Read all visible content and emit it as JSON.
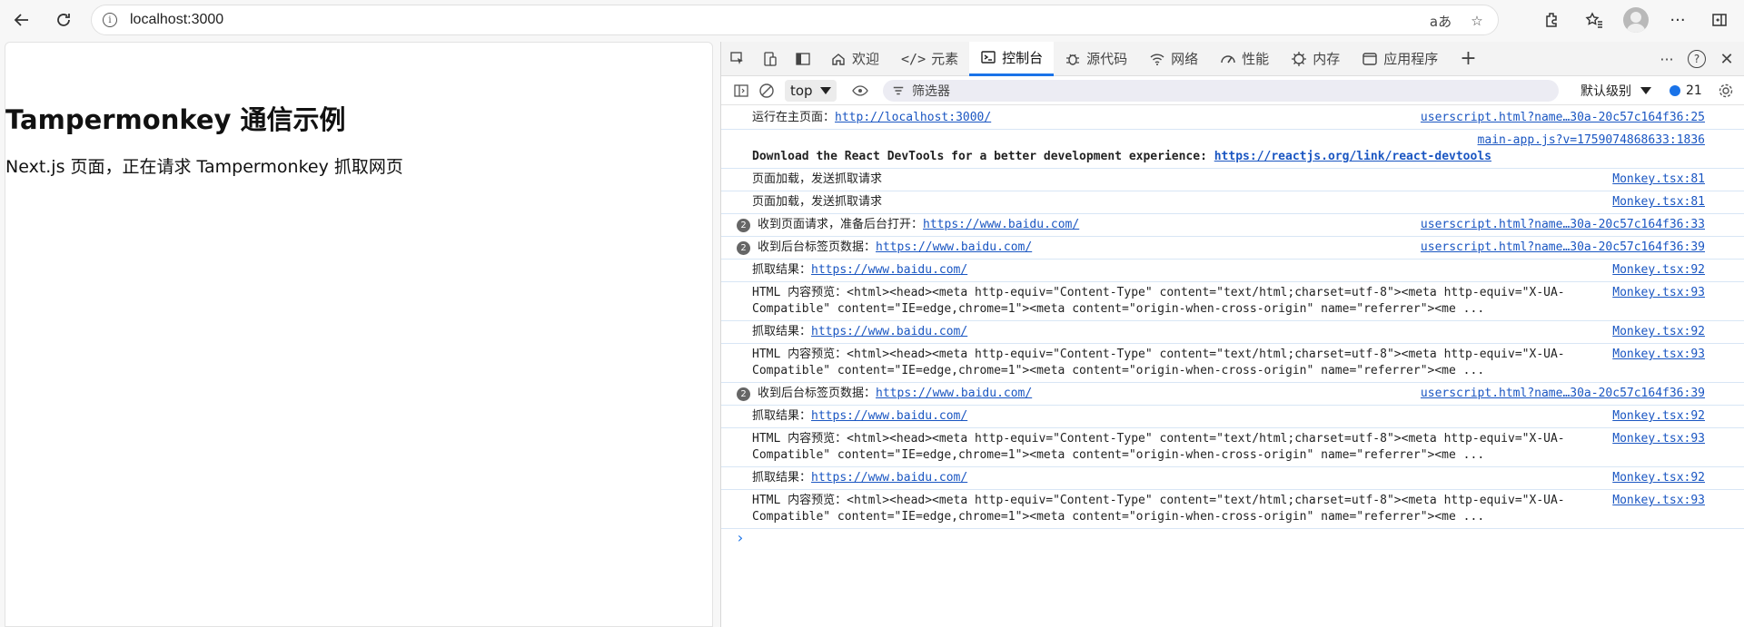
{
  "browser": {
    "url": "localhost:3000",
    "translate_icon": "aあ"
  },
  "page": {
    "title": "Tampermonkey 通信示例",
    "subtitle": "Next.js 页面，正在请求 Tampermonkey 抓取网页"
  },
  "devtools": {
    "tabs": [
      {
        "label": "欢迎"
      },
      {
        "label": "元素"
      },
      {
        "label": "控制台"
      },
      {
        "label": "源代码"
      },
      {
        "label": "网络"
      },
      {
        "label": "性能"
      },
      {
        "label": "内存"
      },
      {
        "label": "应用程序"
      }
    ],
    "context": "top",
    "filter_placeholder": "筛选器",
    "level_label": "默认级别",
    "issue_count": "21"
  },
  "console": {
    "rows": [
      {
        "count": "",
        "text": "运行在主页面：",
        "link": "http://localhost:3000/",
        "source": "userscript.html?name…30a-20c57c164f36:25",
        "bold": false
      },
      {
        "count": "",
        "text": "Download the React DevTools for a better development experience: ",
        "link": "https://reactjs.org/link/react-devtools",
        "source": "main-app.js?v=1759074868633:1836",
        "bold": true
      },
      {
        "count": "",
        "text": "页面加载，发送抓取请求",
        "link": "",
        "source": "Monkey.tsx:81",
        "bold": false
      },
      {
        "count": "",
        "text": "页面加载，发送抓取请求",
        "link": "",
        "source": "Monkey.tsx:81",
        "bold": false
      },
      {
        "count": "2",
        "text": "收到页面请求，准备后台打开：",
        "link": "https://www.baidu.com/",
        "source": "userscript.html?name…30a-20c57c164f36:33",
        "bold": false
      },
      {
        "count": "2",
        "text": "收到后台标签页数据：",
        "link": "https://www.baidu.com/",
        "source": "userscript.html?name…30a-20c57c164f36:39",
        "bold": false
      },
      {
        "count": "",
        "text": "抓取结果：",
        "link": "https://www.baidu.com/",
        "source": "Monkey.tsx:92",
        "bold": false
      },
      {
        "count": "",
        "text": "HTML 内容预览：<html><head><meta http-equiv=\"Content-Type\" content=\"text/html;charset=utf-8\"><meta http-equiv=\"X-UA-Compatible\" content=\"IE=edge,chrome=1\"><meta content=\"origin-when-cross-origin\" name=\"referrer\"><me ...",
        "link": "",
        "source": "Monkey.tsx:93",
        "bold": false
      },
      {
        "count": "",
        "text": "抓取结果：",
        "link": "https://www.baidu.com/",
        "source": "Monkey.tsx:92",
        "bold": false
      },
      {
        "count": "",
        "text": "HTML 内容预览：<html><head><meta http-equiv=\"Content-Type\" content=\"text/html;charset=utf-8\"><meta http-equiv=\"X-UA-Compatible\" content=\"IE=edge,chrome=1\"><meta content=\"origin-when-cross-origin\" name=\"referrer\"><me ...",
        "link": "",
        "source": "Monkey.tsx:93",
        "bold": false
      },
      {
        "count": "2",
        "text": "收到后台标签页数据：",
        "link": "https://www.baidu.com/",
        "source": "userscript.html?name…30a-20c57c164f36:39",
        "bold": false
      },
      {
        "count": "",
        "text": "抓取结果：",
        "link": "https://www.baidu.com/",
        "source": "Monkey.tsx:92",
        "bold": false
      },
      {
        "count": "",
        "text": "HTML 内容预览：<html><head><meta http-equiv=\"Content-Type\" content=\"text/html;charset=utf-8\"><meta http-equiv=\"X-UA-Compatible\" content=\"IE=edge,chrome=1\"><meta content=\"origin-when-cross-origin\" name=\"referrer\"><me ...",
        "link": "",
        "source": "Monkey.tsx:93",
        "bold": false
      },
      {
        "count": "",
        "text": "抓取结果：",
        "link": "https://www.baidu.com/",
        "source": "Monkey.tsx:92",
        "bold": false
      },
      {
        "count": "",
        "text": "HTML 内容预览：<html><head><meta http-equiv=\"Content-Type\" content=\"text/html;charset=utf-8\"><meta http-equiv=\"X-UA-Compatible\" content=\"IE=edge,chrome=1\"><meta content=\"origin-when-cross-origin\" name=\"referrer\"><me ...",
        "link": "",
        "source": "Monkey.tsx:93",
        "bold": false
      }
    ],
    "prompt": "›"
  }
}
